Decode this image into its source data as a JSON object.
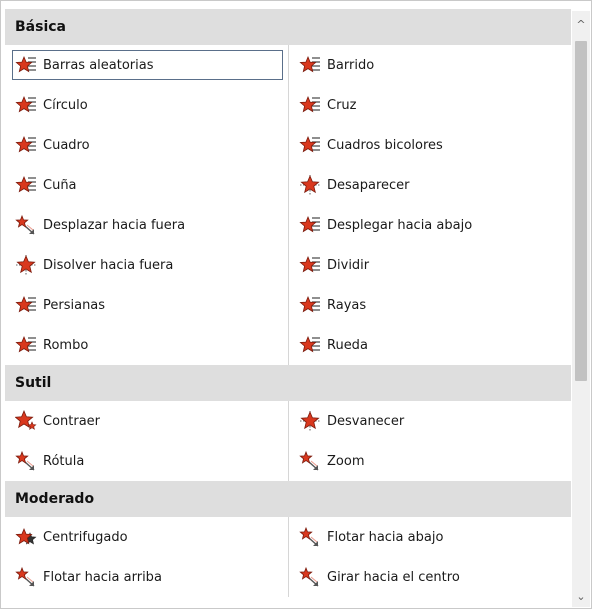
{
  "sections": [
    {
      "title": "Básica",
      "items": [
        {
          "label": "Barras aleatorias",
          "icon": "star-stripes-icon",
          "selected": true
        },
        {
          "label": "Barrido",
          "icon": "star-stripes-icon"
        },
        {
          "label": "Círculo",
          "icon": "star-stripes-icon"
        },
        {
          "label": "Cruz",
          "icon": "star-stripes-icon"
        },
        {
          "label": "Cuadro",
          "icon": "star-stripes-icon"
        },
        {
          "label": "Cuadros bicolores",
          "icon": "star-stripes-icon"
        },
        {
          "label": "Cuña",
          "icon": "star-stripes-icon"
        },
        {
          "label": "Desaparecer",
          "icon": "star-burst-icon"
        },
        {
          "label": "Desplazar hacia fuera",
          "icon": "star-arrow-icon"
        },
        {
          "label": "Desplegar hacia abajo",
          "icon": "star-stripes-icon"
        },
        {
          "label": "Disolver hacia fuera",
          "icon": "star-burst-icon"
        },
        {
          "label": "Dividir",
          "icon": "star-stripes-icon"
        },
        {
          "label": "Persianas",
          "icon": "star-stripes-icon"
        },
        {
          "label": "Rayas",
          "icon": "star-stripes-icon"
        },
        {
          "label": "Rombo",
          "icon": "star-stripes-icon"
        },
        {
          "label": "Rueda",
          "icon": "star-stripes-icon"
        }
      ]
    },
    {
      "title": "Sutil",
      "items": [
        {
          "label": "Contraer",
          "icon": "star-shrink-icon"
        },
        {
          "label": "Desvanecer",
          "icon": "star-burst-icon"
        },
        {
          "label": "Rótula",
          "icon": "star-arrow-icon"
        },
        {
          "label": "Zoom",
          "icon": "star-arrow-icon"
        }
      ]
    },
    {
      "title": "Moderado",
      "items": [
        {
          "label": "Centrifugado",
          "icon": "star-spin-icon"
        },
        {
          "label": "Flotar hacia abajo",
          "icon": "star-arrow-icon"
        },
        {
          "label": "Flotar hacia arriba",
          "icon": "star-arrow-icon"
        },
        {
          "label": "Girar hacia el centro",
          "icon": "star-arrow-icon"
        }
      ]
    }
  ],
  "scrollbar": {
    "up_arrow": "^",
    "down_arrow": "⌄"
  },
  "colors": {
    "star": "#d9381e",
    "star_outline": "#7a1a0c",
    "header_bg": "#dedede"
  }
}
